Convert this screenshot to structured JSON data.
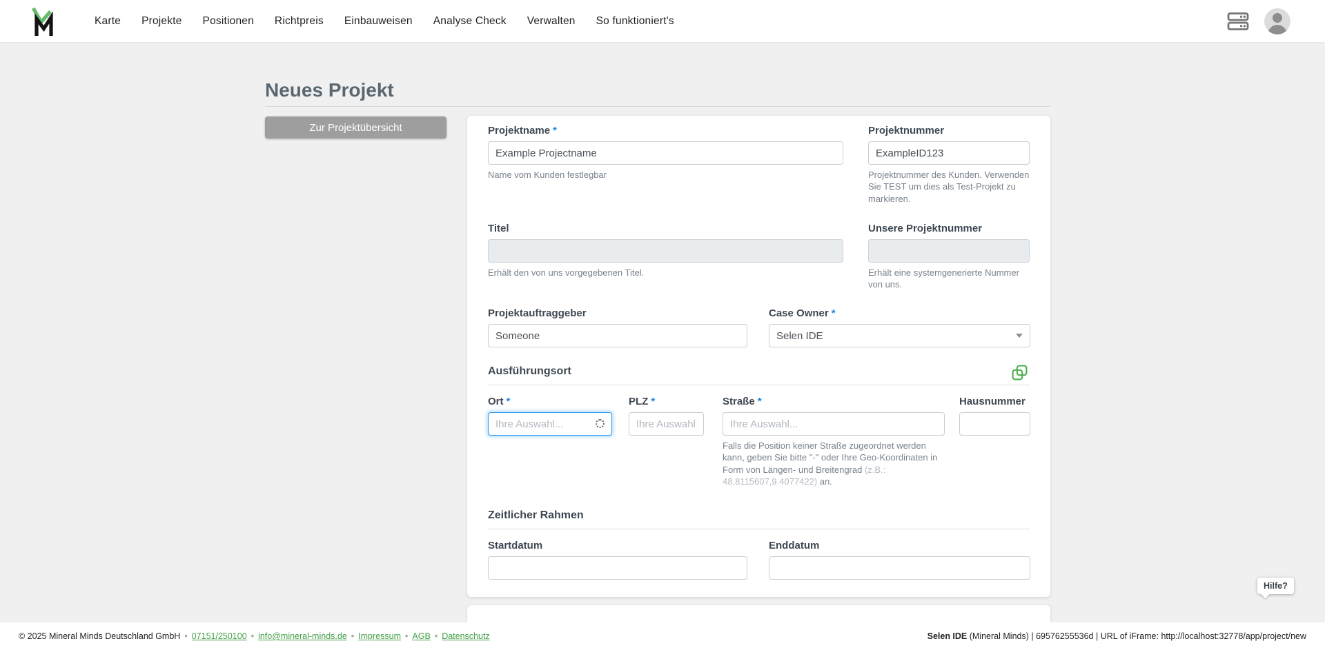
{
  "nav": {
    "items": [
      "Karte",
      "Projekte",
      "Positionen",
      "Richtpreis",
      "Einbauweisen",
      "Analyse Check",
      "Verwalten",
      "So funktioniert's"
    ],
    "icons": [
      "mineral-minds-logo",
      "server-icon",
      "user-avatar-icon"
    ]
  },
  "page": {
    "title": "Neues Projekt",
    "back_button": "Zur Projektübersicht"
  },
  "form": {
    "required_marker": "*",
    "projektname": {
      "label": "Projektname",
      "value": "Example Projectname",
      "helper": "Name vom Kunden festlegbar"
    },
    "projektnummer": {
      "label": "Projektnummer",
      "value": "ExampleID123",
      "helper": "Projektnummer des Kunden. Verwenden Sie TEST um dies als Test-Projekt zu markieren."
    },
    "titel": {
      "label": "Titel",
      "value": "",
      "helper": "Erhält den von uns vorgegebenen Titel."
    },
    "unsere_projektnummer": {
      "label": "Unsere Projektnummer",
      "value": "",
      "helper": "Erhält eine systemgenerierte Nummer von uns."
    },
    "projektauftraggeber": {
      "label": "Projektauftraggeber",
      "value": "Someone"
    },
    "case_owner": {
      "label": "Case Owner",
      "value": "Selen IDE"
    },
    "ausfuehrungsort": {
      "heading": "Ausführungsort",
      "copy_icon": "copy-icon",
      "ort": {
        "label": "Ort",
        "placeholder": "Ihre Auswahl...",
        "state": "focused, loading-spinner visible"
      },
      "plz": {
        "label": "PLZ",
        "placeholder": "Ihre Auswahl.."
      },
      "strasse": {
        "label": "Straße",
        "placeholder": "Ihre Auswahl...",
        "helper_main": "Falls die Position keiner Straße zugeordnet werden kann, geben Sie bitte \"-\" oder Ihre Geo-Koordinaten in Form von Längen- und Breitengrad ",
        "helper_example": "(z.B.: 48.8115607,9.4077422)",
        "helper_suffix": " an."
      },
      "hausnummer": {
        "label": "Hausnummer",
        "value": ""
      }
    },
    "zeitlicher_rahmen": {
      "heading": "Zeitlicher Rahmen",
      "startdatum": {
        "label": "Startdatum",
        "value": ""
      },
      "enddatum": {
        "label": "Enddatum",
        "value": ""
      }
    }
  },
  "help": {
    "label": "Hilfe?"
  },
  "footer": {
    "copyright": "© 2025 Mineral Minds Deutschland GmbH",
    "separator": "•",
    "links": [
      "07151/250100",
      "info@mineral-minds.de",
      "Impressum",
      "AGB",
      "Datenschutz"
    ],
    "right_bold": "Selen IDE",
    "right_rest": " (Mineral Minds) | 69576255536d | URL of iFrame: http://localhost:32778/app/project/new"
  },
  "colors": {
    "accent_green": "#4caf50",
    "logo_green": "#66bb6a",
    "link_green": "#43a047",
    "asterisk_blue": "#1e88e5",
    "focus_blue": "#2196f3",
    "button_gray": "#9e9e9e",
    "page_background": "#f0f0f0"
  }
}
